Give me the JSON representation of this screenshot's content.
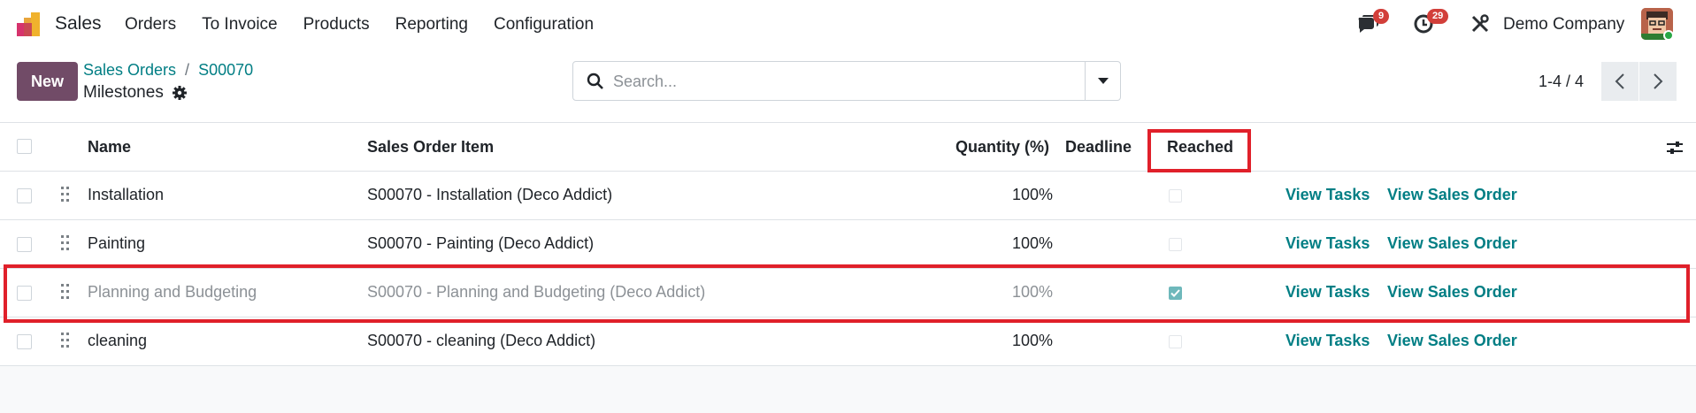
{
  "nav": {
    "app_name": "Sales",
    "menu": [
      "Orders",
      "To Invoice",
      "Products",
      "Reporting",
      "Configuration"
    ],
    "messages_count": "9",
    "activities_count": "29",
    "company": "Demo Company"
  },
  "control": {
    "new_label": "New",
    "breadcrumb_parent": "Sales Orders",
    "breadcrumb_sep": "/",
    "breadcrumb_current": "S00070",
    "title": "Milestones",
    "search_placeholder": "Search...",
    "pager": "1-4 / 4"
  },
  "table": {
    "headers": {
      "name": "Name",
      "item": "Sales Order Item",
      "quantity": "Quantity (%)",
      "deadline": "Deadline",
      "reached": "Reached"
    },
    "view_tasks_label": "View Tasks",
    "view_order_label": "View Sales Order",
    "rows": [
      {
        "name": "Installation",
        "item": "S00070 - Installation (Deco Addict)",
        "quantity": "100%",
        "reached": false
      },
      {
        "name": "Painting",
        "item": "S00070 - Painting (Deco Addict)",
        "quantity": "100%",
        "reached": false
      },
      {
        "name": "Planning and Budgeting",
        "item": "S00070 - Planning and Budgeting (Deco Addict)",
        "quantity": "100%",
        "reached": true
      },
      {
        "name": "cleaning",
        "item": "S00070 - cleaning (Deco Addict)",
        "quantity": "100%",
        "reached": false
      }
    ]
  },
  "colors": {
    "brand": "#714b67",
    "link": "#017e84",
    "highlight": "#e0202a",
    "badge": "#d23f3a"
  }
}
